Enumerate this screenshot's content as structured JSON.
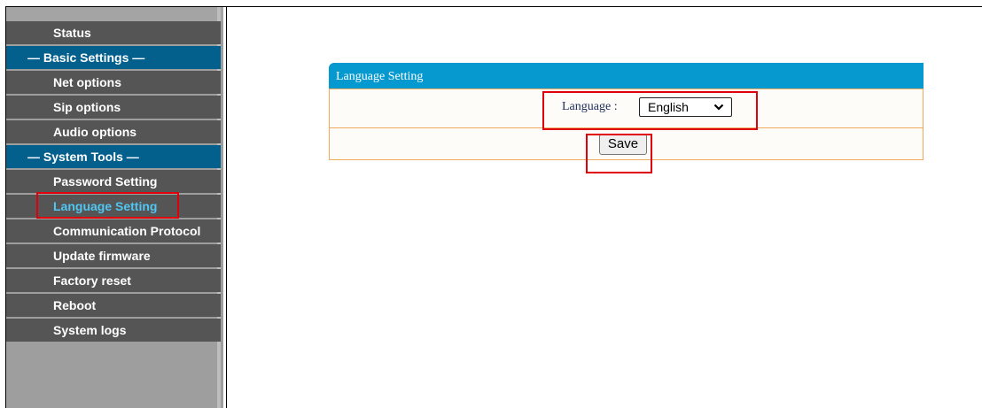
{
  "sidebar": {
    "items": [
      {
        "label": "Status",
        "type": "item"
      },
      {
        "label": "— Basic Settings —",
        "type": "section"
      },
      {
        "label": "Net options",
        "type": "item"
      },
      {
        "label": "Sip options",
        "type": "item"
      },
      {
        "label": "Audio options",
        "type": "item"
      },
      {
        "label": "— System Tools —",
        "type": "section"
      },
      {
        "label": "Password Setting",
        "type": "item"
      },
      {
        "label": "Language Setting",
        "type": "item",
        "active": true
      },
      {
        "label": "Communication Protocol",
        "type": "item"
      },
      {
        "label": "Update firmware",
        "type": "item"
      },
      {
        "label": "Factory reset",
        "type": "item"
      },
      {
        "label": "Reboot",
        "type": "item"
      },
      {
        "label": "System logs",
        "type": "item"
      }
    ]
  },
  "panel": {
    "title": "Language Setting",
    "language_label": "Language :",
    "language_value": "English",
    "save_label": "Save"
  },
  "colors": {
    "menu_bg": "#555555",
    "section_bg": "#035f8c",
    "active_text": "#4fc6f3",
    "header_bg": "#0599d0",
    "row_border": "#efaa5d",
    "highlight": "#e0000c"
  },
  "icons": {
    "select_arrow": "chevron-down-icon"
  }
}
